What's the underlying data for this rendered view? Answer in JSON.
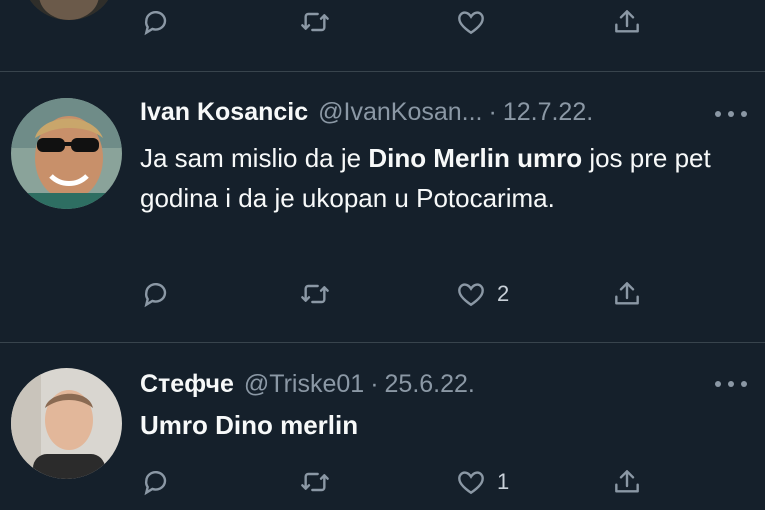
{
  "tweets": [
    {
      "actions": {
        "reply_icon": "reply-icon",
        "retweet_icon": "retweet-icon",
        "like_icon": "like-icon",
        "share_icon": "share-icon",
        "like_count": ""
      }
    },
    {
      "name": "Ivan Kosancic",
      "handle": "@IvanKosan...",
      "dot": "·",
      "date": "12.7.22.",
      "text_part1": "Ja sam mislio da je ",
      "text_bold": "Dino Merlin umro",
      "text_part2": " jos pre pet godina i da je ukopan u Potocarima.",
      "actions": {
        "like_count": "2"
      }
    },
    {
      "name": "Стефче",
      "handle": "@Triske01",
      "dot": "·",
      "date": "25.6.22.",
      "text_bold": "Umro Dino merlin",
      "actions": {
        "like_count": "1"
      }
    }
  ],
  "colors": {
    "background": "#15202b",
    "text": "#f7f9f9",
    "muted": "#8b98a5",
    "divider": "#38444d"
  }
}
